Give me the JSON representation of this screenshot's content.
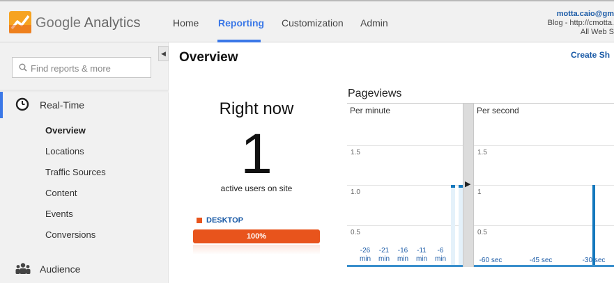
{
  "header": {
    "brand_google": "Google",
    "brand_product": "Analytics",
    "nav": [
      {
        "label": "Home",
        "active": false
      },
      {
        "label": "Reporting",
        "active": true
      },
      {
        "label": "Customization",
        "active": false
      },
      {
        "label": "Admin",
        "active": false
      }
    ],
    "account": {
      "email": "motta.caio@gm",
      "property": "Blog - http://cmotta.",
      "view": "All Web S"
    }
  },
  "sidebar": {
    "search_placeholder": "Find reports & more",
    "realtime_label": "Real-Time",
    "realtime_items": [
      "Overview",
      "Locations",
      "Traffic Sources",
      "Content",
      "Events",
      "Conversions"
    ],
    "audience_label": "Audience"
  },
  "main": {
    "page_title": "Overview",
    "create_shortcut": "Create Sh",
    "right_now": {
      "title": "Right now",
      "active_users": "1",
      "subtitle": "active users on site"
    },
    "device": {
      "label": "DESKTOP",
      "percent_text": "100%",
      "percent_value": 100,
      "color": "#e8541c"
    },
    "pageviews_title": "Pageviews"
  },
  "chart_data": [
    {
      "type": "bar",
      "title": "Per minute",
      "ylabel": "",
      "xlabel": "",
      "y_ticks": [
        "1.5",
        "1.0",
        "0.5"
      ],
      "ylim": [
        0,
        1.5
      ],
      "x_tick_labels": [
        {
          "value": "-26",
          "unit": "min"
        },
        {
          "value": "-21",
          "unit": "min"
        },
        {
          "value": "-16",
          "unit": "min"
        },
        {
          "value": "-11",
          "unit": "min"
        },
        {
          "value": "-6",
          "unit": "min"
        }
      ],
      "x": [
        -30,
        -29,
        -28,
        -27,
        -26,
        -25,
        -24,
        -23,
        -22,
        -21,
        -20,
        -19,
        -18,
        -17,
        -16,
        -15,
        -14,
        -13,
        -12,
        -11,
        -10,
        -9,
        -8,
        -7,
        -6,
        -5,
        -4,
        -3,
        -2,
        -1
      ],
      "values": [
        0,
        0,
        0,
        0,
        0,
        0,
        0,
        0,
        0,
        0,
        0,
        0,
        0,
        0,
        0,
        0,
        0,
        0,
        0,
        0,
        0,
        0,
        0,
        0,
        0,
        0,
        0,
        1,
        0,
        1
      ]
    },
    {
      "type": "bar",
      "title": "Per second",
      "ylabel": "",
      "xlabel": "",
      "y_ticks": [
        "1.5",
        "1",
        "0.5"
      ],
      "ylim": [
        0,
        1.5
      ],
      "x_tick_labels": [
        "-60 sec",
        "-45 sec",
        "-30 sec"
      ],
      "x": [
        -60,
        -59,
        -58,
        -57,
        -56,
        -55,
        -54,
        -53,
        -52,
        -51,
        -50,
        -49,
        -48,
        -47,
        -46,
        -45,
        -44,
        -43,
        -42,
        -41,
        -40,
        -39,
        -38,
        -37,
        -36,
        -35,
        -34,
        -33,
        -32,
        -31,
        -30,
        -29
      ],
      "values": [
        0,
        0,
        0,
        0,
        0,
        0,
        0,
        0,
        0,
        0,
        0,
        0,
        0,
        0,
        0,
        0,
        0,
        0,
        0,
        0,
        0,
        0,
        0,
        0,
        0,
        0,
        0,
        1,
        0,
        0,
        0,
        0
      ]
    }
  ],
  "colors": {
    "accent": "#3b78e7",
    "link": "#1a5aa6",
    "bar": "#1478bd",
    "device": "#e8541c"
  }
}
